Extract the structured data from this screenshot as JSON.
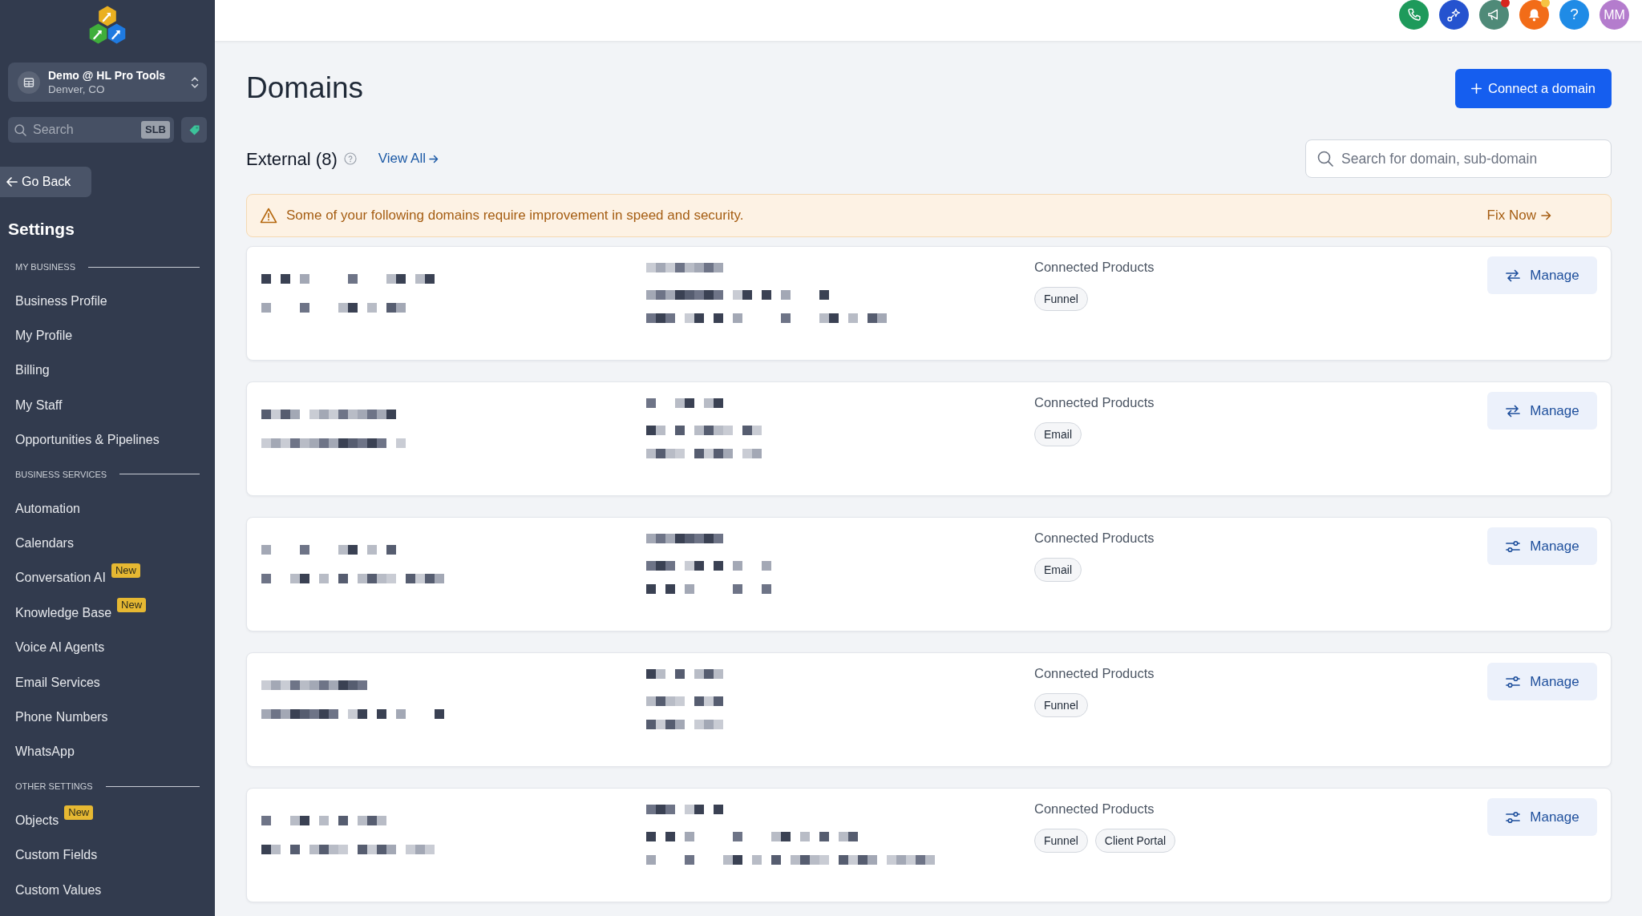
{
  "sidebar": {
    "account": {
      "name": "Demo @ HL Pro Tools",
      "location": "Denver, CO"
    },
    "search": {
      "placeholder": "Search",
      "shortcut": "SLB"
    },
    "go_back": "Go Back",
    "title": "Settings",
    "sections": [
      {
        "title": "MY BUSINESS",
        "items": [
          {
            "label": "Business Profile",
            "selected": false
          },
          {
            "label": "My Profile",
            "selected": false
          },
          {
            "label": "Billing",
            "selected": false
          },
          {
            "label": "My Staff",
            "selected": false
          },
          {
            "label": "Opportunities & Pipelines",
            "selected": false
          }
        ]
      },
      {
        "title": "BUSINESS SERVICES",
        "items": [
          {
            "label": "Automation",
            "selected": false
          },
          {
            "label": "Calendars",
            "selected": false
          },
          {
            "label": "Conversation AI",
            "badge": "New",
            "selected": false
          },
          {
            "label": "Knowledge Base",
            "badge": "New",
            "selected": false
          },
          {
            "label": "Voice AI Agents",
            "selected": false
          },
          {
            "label": "Email Services",
            "selected": false
          },
          {
            "label": "Phone Numbers",
            "selected": false
          },
          {
            "label": "WhatsApp",
            "selected": false
          }
        ]
      },
      {
        "title": "OTHER SETTINGS",
        "items": [
          {
            "label": "Objects",
            "badge": "New",
            "selected": false
          },
          {
            "label": "Custom Fields",
            "selected": false
          },
          {
            "label": "Custom Values",
            "selected": false
          }
        ]
      }
    ]
  },
  "header_actions": [
    {
      "kind": "phone",
      "badge": false
    },
    {
      "kind": "connect",
      "badge": false
    },
    {
      "kind": "announcements",
      "badge": true
    },
    {
      "kind": "notifications",
      "badge": true
    },
    {
      "kind": "help",
      "label": "?",
      "badge": false
    },
    {
      "kind": "avatar",
      "label": "MM",
      "badge": false
    }
  ],
  "page_title": "Domains",
  "connect_button": "Connect a domain",
  "external": {
    "title": "External (8)",
    "view_all": "View All"
  },
  "domain_search": {
    "placeholder": "Search for domain, sub-domain"
  },
  "alert": {
    "message": "Some of your following domains require improvement in speed and security.",
    "action": "Fix Now"
  },
  "domains": [
    {
      "kind": "arrows",
      "connected_label": "Connected Products",
      "products": [
        "Funnel"
      ],
      "manage": "Manage"
    },
    {
      "kind": "arrows",
      "connected_label": "Connected Products",
      "products": [
        "Email"
      ],
      "manage": "Manage"
    },
    {
      "kind": "sliders",
      "connected_label": "Connected Products",
      "products": [
        "Email"
      ],
      "manage": "Manage"
    },
    {
      "kind": "sliders",
      "connected_label": "Connected Products",
      "products": [
        "Funnel"
      ],
      "manage": "Manage"
    },
    {
      "kind": "sliders",
      "connected_label": "Connected Products",
      "products": [
        "Funnel",
        "Client Portal"
      ],
      "manage": "Manage"
    }
  ]
}
